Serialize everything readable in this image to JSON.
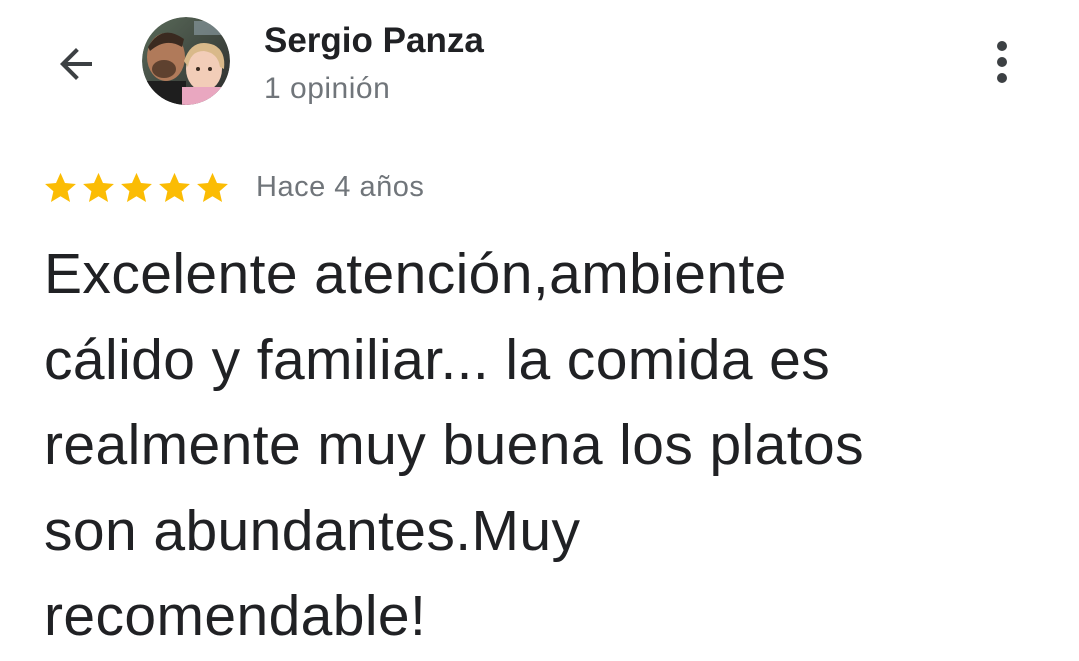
{
  "header": {
    "back_icon": "arrow-left-icon",
    "avatar_icon": "user-avatar-photo",
    "user_name": "Sergio Panza",
    "review_count": "1 opinión",
    "more_icon": "more-vert-icon"
  },
  "review": {
    "rating": 5,
    "rating_max": 5,
    "star_color": "#fbbc04",
    "date": "Hace 4 años",
    "lines": [
      "Excelente atención,ambiente",
      "cálido y familiar... la comida es",
      "realmente muy buena los platos",
      "son abundantes.Muy",
      "recomendable!"
    ]
  },
  "colors": {
    "text_primary": "#202124",
    "text_secondary": "#70757a",
    "background": "#ffffff"
  }
}
